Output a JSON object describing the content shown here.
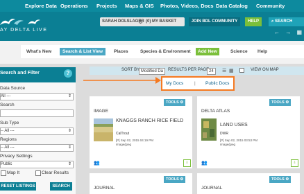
{
  "top_nav": [
    "Explore Data",
    "Operations",
    "Projects",
    "Maps & GIS",
    "Photos, Videos, Docs",
    "Data Catalog",
    "Community"
  ],
  "logo": {
    "text": "AY DELTA LIVE"
  },
  "header": {
    "user_name": "SARAH DOLSLAGER",
    "basket": "(0) MY BASKET",
    "join": "JOIN BDL COMMUNITY",
    "help": "HELP",
    "search": "SEARCH"
  },
  "sub_nav": [
    "What's New",
    "Search & List View",
    "Places",
    "Species & Environment",
    "Add New",
    "Science",
    "Help"
  ],
  "sidebar": {
    "title": "Search and Filter",
    "help_glyph": "?",
    "data_source": {
      "label": "Data Source",
      "value": "All ---"
    },
    "search": {
      "label": "Search",
      "value": ""
    },
    "sub_type": {
      "label": "Sub Type",
      "value": "-- All ---"
    },
    "regions": {
      "label": "Regions",
      "value": "-- All ---"
    },
    "privacy": {
      "label": "Privacy Settings",
      "value": "Public"
    },
    "map_it": "Map It",
    "clear_results": "Clear Results",
    "reset": "RESET LISTINGS",
    "search_btn": "SEARCH"
  },
  "sort_bar": {
    "sort_by": "SORT BY",
    "sort_value": "Modified Da",
    "results": "RESULTS PER PAGE",
    "per_page": "24",
    "view_on_map": "VIEW ON MAP"
  },
  "docs_tabs": {
    "my": "My Docs",
    "sep": "|",
    "public": "Public Docs"
  },
  "cards": [
    {
      "tools": "TOOLS",
      "type": "IMAGE",
      "title": "KNAGGS RANCH RICE FIELD",
      "sub": "CalTrout",
      "meta1": "[P] Sep 02, 2015 04:19 PM",
      "meta2": "image/jpeg"
    },
    {
      "tools": "TOOLS",
      "type": "DELTA ATLAS",
      "title": "LAND USES",
      "sub": "DWR",
      "meta1": "[P] Sep 02, 2015 03:53 PM",
      "meta2": "image/jpeg"
    },
    {
      "tools": "TOOLS",
      "type": "JOURNAL"
    },
    {
      "tools": "TOOLS",
      "type": "JOURNAL"
    }
  ],
  "colors": {
    "teal": "#0b7f94",
    "green": "#7bbf3a",
    "orange": "#f57920",
    "light_blue": "#4aa7c4"
  }
}
